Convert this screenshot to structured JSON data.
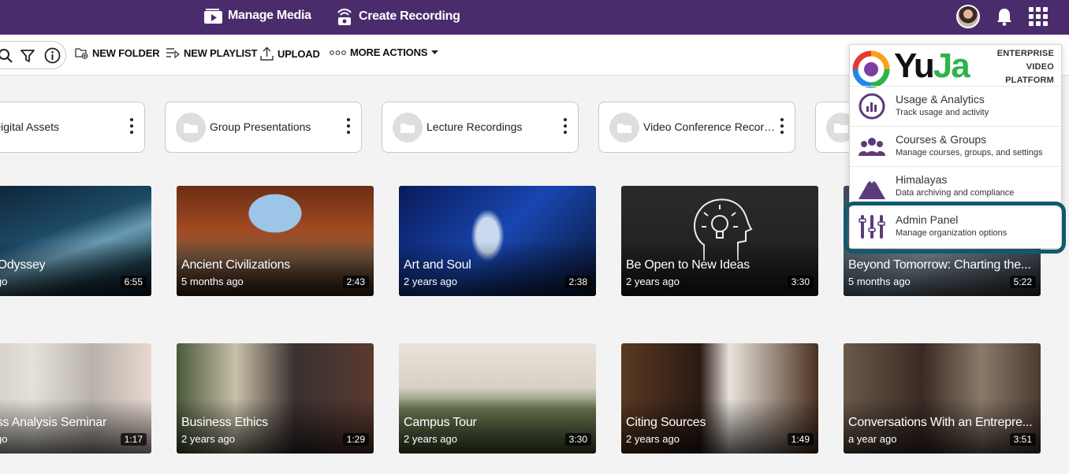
{
  "topbar": {
    "manage_media": "Manage Media",
    "create_recording": "Create Recording"
  },
  "toolbar": {
    "new_folder": "NEW FOLDER",
    "new_playlist": "NEW PLAYLIST",
    "upload": "UPLOAD",
    "more_actions": "MORE ACTIONS"
  },
  "folders": [
    {
      "name": "Digital Assets"
    },
    {
      "name": "Group Presentations"
    },
    {
      "name": "Lecture Recordings"
    },
    {
      "name": "Video Conference Recordings"
    }
  ],
  "videos_row1": [
    {
      "title": "Space Odyssey",
      "age": "a year ago",
      "duration": "6:55"
    },
    {
      "title": "Ancient Civilizations",
      "age": "5 months ago",
      "duration": "2:43"
    },
    {
      "title": "Art and Soul",
      "age": "2 years ago",
      "duration": "2:38"
    },
    {
      "title": "Be Open to New Ideas",
      "age": "2 years ago",
      "duration": "3:30"
    },
    {
      "title": "Beyond Tomorrow: Charting the...",
      "age": "5 months ago",
      "duration": "5:22"
    }
  ],
  "videos_row2": [
    {
      "title": "Business Analysis Seminar",
      "age": "a year ago",
      "duration": "1:17"
    },
    {
      "title": "Business Ethics",
      "age": "2 years ago",
      "duration": "1:29"
    },
    {
      "title": "Campus Tour",
      "age": "2 years ago",
      "duration": "3:30"
    },
    {
      "title": "Citing Sources",
      "age": "2 years ago",
      "duration": "1:49"
    },
    {
      "title": "Conversations With an Entrepre...",
      "age": "a year ago",
      "duration": "3:51"
    }
  ],
  "menu": {
    "brand": "YuJa",
    "tagline_1": "ENTERPRISE",
    "tagline_2": "VIDEO",
    "tagline_3": "PLATFORM",
    "items": [
      {
        "title": "Usage & Analytics",
        "subtitle": "Track usage and activity",
        "icon": "analytics-icon"
      },
      {
        "title": "Courses & Groups",
        "subtitle": "Manage courses, groups, and settings",
        "icon": "people-icon"
      },
      {
        "title": "Himalayas",
        "subtitle": "Data archiving and compliance",
        "icon": "mountain-icon"
      },
      {
        "title": "Admin Panel",
        "subtitle": "Manage organization options",
        "icon": "sliders-icon"
      }
    ]
  },
  "colors": {
    "topbar": "#4a2c6d",
    "highlight": "#0e5a6e",
    "menu_icon_purple": "#5b3b7a"
  }
}
